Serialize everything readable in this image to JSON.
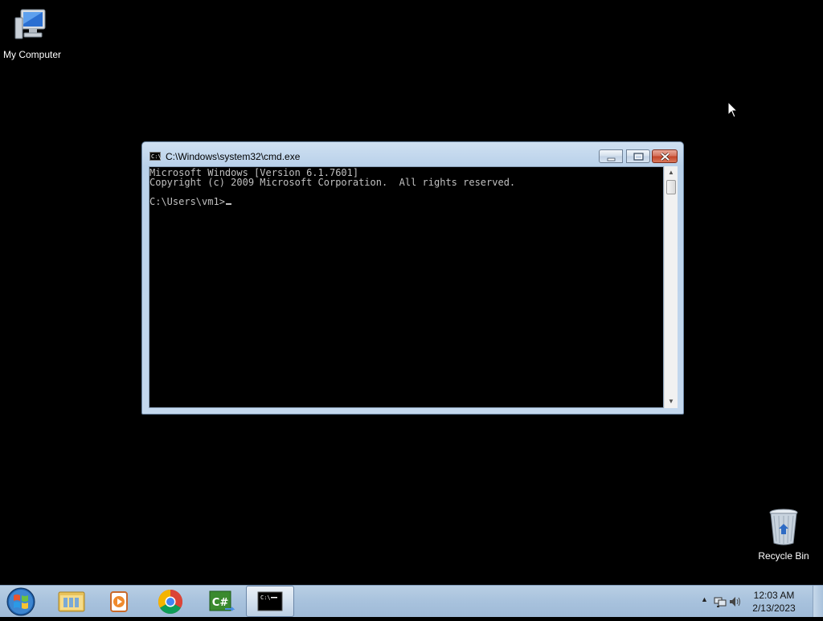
{
  "desktop": {
    "icons": [
      {
        "label": "My Computer",
        "icon": "computer-icon"
      },
      {
        "label": "Recycle Bin",
        "icon": "recycle-bin-icon"
      }
    ]
  },
  "cmd_window": {
    "title": "C:\\Windows\\system32\\cmd.exe",
    "console_lines": [
      "Microsoft Windows [Version 6.1.7601]",
      "Copyright (c) 2009 Microsoft Corporation.  All rights reserved.",
      "",
      "C:\\Users\\vm1>"
    ],
    "buttons": {
      "minimize": "minimize-icon",
      "maximize": "maximize-icon",
      "close": "close-icon"
    }
  },
  "taskbar": {
    "start": "windows-start-icon",
    "pinned": [
      {
        "name": "file-explorer-icon"
      },
      {
        "name": "media-player-icon"
      },
      {
        "name": "chrome-icon"
      },
      {
        "name": "csharp-icon"
      },
      {
        "name": "cmd-icon",
        "active": true
      }
    ],
    "tray": {
      "icons": [
        "show-hidden-icons-arrow",
        "network-icon",
        "volume-icon"
      ],
      "time": "12:03 AM",
      "date": "2/13/2023"
    }
  },
  "colors": {
    "desktop_bg": "#000000",
    "console_bg": "#000000",
    "console_fg": "#c0c0c0",
    "taskbar": "#a8c2dd",
    "close_button": "#c24226"
  }
}
